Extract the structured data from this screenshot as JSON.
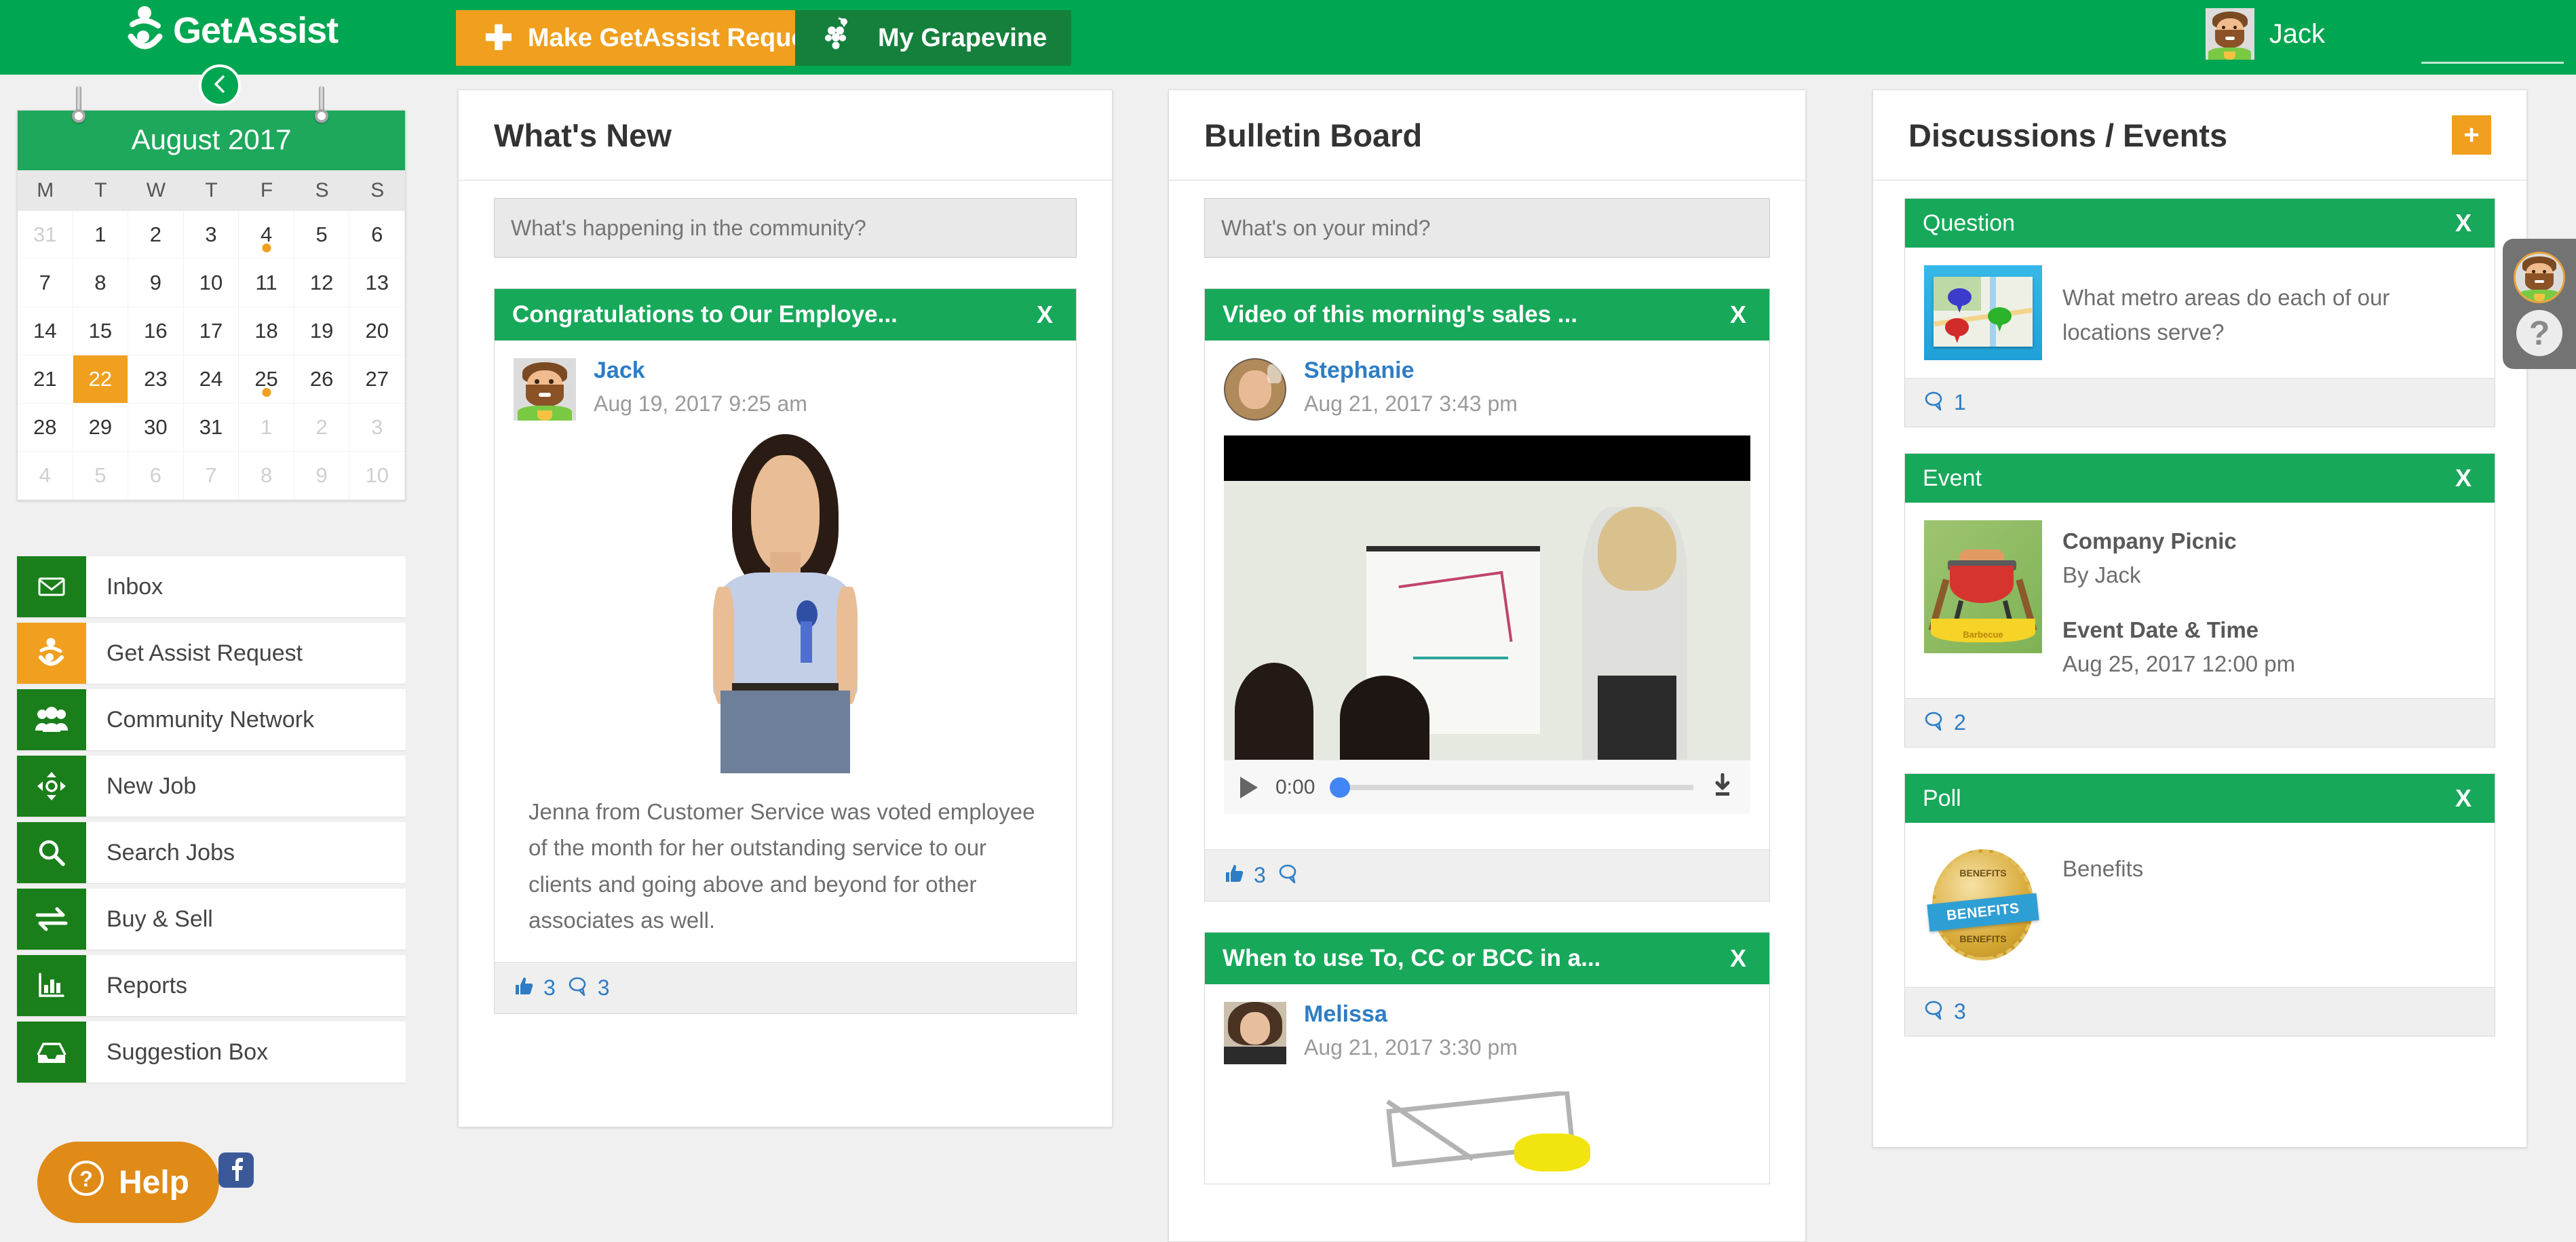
{
  "brand": {
    "name": "GetAssist",
    "green": "#00a651",
    "orange": "#f0a01e",
    "dark_green": "#14803c",
    "link_blue": "#2d7dc4"
  },
  "header": {
    "logo_text": "GetAssist",
    "request_button": "Make GetAssist Request",
    "grapevine_button": "My Grapevine",
    "user_name": "Jack"
  },
  "calendar": {
    "month_label": "August 2017",
    "day_headers": [
      "M",
      "T",
      "W",
      "T",
      "F",
      "S",
      "S"
    ],
    "weeks": [
      [
        {
          "d": "31",
          "muted": true
        },
        {
          "d": "1"
        },
        {
          "d": "2"
        },
        {
          "d": "3"
        },
        {
          "d": "4",
          "dot": true
        },
        {
          "d": "5"
        },
        {
          "d": "6"
        }
      ],
      [
        {
          "d": "7"
        },
        {
          "d": "8"
        },
        {
          "d": "9"
        },
        {
          "d": "10"
        },
        {
          "d": "11"
        },
        {
          "d": "12"
        },
        {
          "d": "13"
        }
      ],
      [
        {
          "d": "14"
        },
        {
          "d": "15"
        },
        {
          "d": "16"
        },
        {
          "d": "17"
        },
        {
          "d": "18"
        },
        {
          "d": "19"
        },
        {
          "d": "20"
        }
      ],
      [
        {
          "d": "21"
        },
        {
          "d": "22",
          "today": true
        },
        {
          "d": "23"
        },
        {
          "d": "24"
        },
        {
          "d": "25",
          "dot": true
        },
        {
          "d": "26"
        },
        {
          "d": "27"
        }
      ],
      [
        {
          "d": "28"
        },
        {
          "d": "29"
        },
        {
          "d": "30"
        },
        {
          "d": "31"
        },
        {
          "d": "1",
          "muted": true
        },
        {
          "d": "2",
          "muted": true
        },
        {
          "d": "3",
          "muted": true
        }
      ],
      [
        {
          "d": "4",
          "muted": true
        },
        {
          "d": "5",
          "muted": true
        },
        {
          "d": "6",
          "muted": true
        },
        {
          "d": "7",
          "muted": true
        },
        {
          "d": "8",
          "muted": true
        },
        {
          "d": "9",
          "muted": true
        },
        {
          "d": "10",
          "muted": true
        }
      ]
    ]
  },
  "sidebar": {
    "items": [
      {
        "label": "Inbox",
        "icon": "envelope-icon",
        "color": "green"
      },
      {
        "label": "Get Assist Request",
        "icon": "getassist-icon",
        "color": "orange"
      },
      {
        "label": "Community Network",
        "icon": "people-group-icon",
        "color": "green"
      },
      {
        "label": "New Job",
        "icon": "move-arrows-icon",
        "color": "green"
      },
      {
        "label": "Search Jobs",
        "icon": "magnifier-icon",
        "color": "green"
      },
      {
        "label": "Buy & Sell",
        "icon": "exchange-arrows-icon",
        "color": "green"
      },
      {
        "label": "Reports",
        "icon": "bar-chart-icon",
        "color": "green"
      },
      {
        "label": "Suggestion Box",
        "icon": "inbox-tray-icon",
        "color": "green"
      }
    ],
    "help_label": "Help",
    "facebook_label": "f"
  },
  "whats_new": {
    "title": "What's New",
    "composer_placeholder": "What's happening in the community?",
    "posts": [
      {
        "title": "Congratulations to Our Employe...",
        "close_label": "X",
        "author": "Jack",
        "date": "Aug 19, 2017 9:25 am",
        "text": "Jenna from Customer Service was voted employee of the month for her outstanding service to our clients and going above and beyond for other associates as well.",
        "likes": "3",
        "comments": "3"
      }
    ]
  },
  "bulletin_board": {
    "title": "Bulletin Board",
    "composer_placeholder": "What's on your mind?",
    "posts": [
      {
        "title": "Video of this morning's sales ...",
        "close_label": "X",
        "author": "Stephanie",
        "date": "Aug 21, 2017 3:43 pm",
        "video_time": "0:00",
        "likes": "3",
        "comments": ""
      },
      {
        "title": "When to use To, CC or BCC in a...",
        "close_label": "X",
        "author": "Melissa",
        "date": "Aug 21, 2017 3:30 pm"
      }
    ]
  },
  "discussions": {
    "title": "Discussions / Events",
    "add_label": "+",
    "cards": [
      {
        "type": "Question",
        "close_label": "X",
        "thumb": "map-thumbnail",
        "text": "What metro areas do each of our locations serve?",
        "comments": "1"
      },
      {
        "type": "Event",
        "close_label": "X",
        "thumb": "barbecue-thumbnail",
        "name": "Company Picnic",
        "by": "By Jack",
        "datetime_label": "Event Date & Time",
        "datetime": "Aug 25, 2017 12:00 pm",
        "comments": "2"
      },
      {
        "type": "Poll",
        "close_label": "X",
        "thumb": "benefits-badge-thumbnail",
        "name": "Benefits",
        "badge_top": "BENEFITS",
        "badge_ribbon": "BENEFITS",
        "badge_bottom": "BENEFITS",
        "comments": "3"
      }
    ]
  },
  "float_widget": {
    "help_glyph": "?"
  }
}
